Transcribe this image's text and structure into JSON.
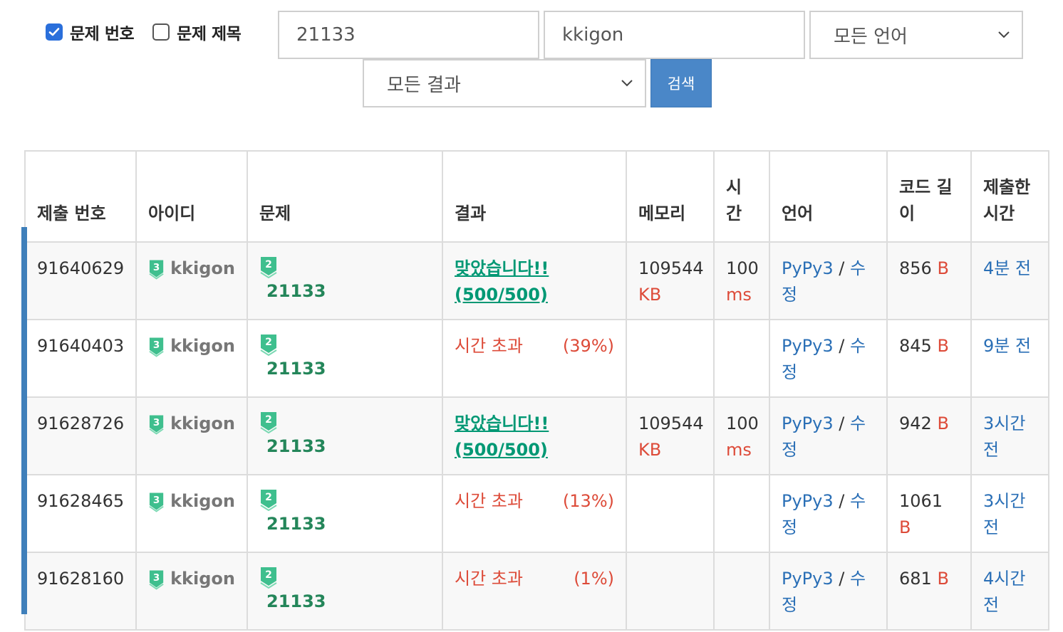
{
  "filters": {
    "problem_number_label": "문제 번호",
    "problem_number_checked": true,
    "problem_title_label": "문제 제목",
    "problem_title_checked": false,
    "problem_input_value": "21133",
    "user_input_value": "kkigon",
    "language_select_value": "모든 언어",
    "result_select_value": "모든 결과",
    "search_button_label": "검색"
  },
  "table": {
    "headers": [
      "제출 번호",
      "아이디",
      "문제",
      "결과",
      "메모리",
      "시간",
      "언어",
      "코드 길이",
      "제출한 시간"
    ],
    "rows": [
      {
        "id": "91640629",
        "user": "kkigon",
        "user_tier": "3",
        "problem": "21133",
        "problem_tier": "2",
        "result": "맞았습니다!! (500/500)",
        "result_score": "",
        "memory": "109544",
        "memory_unit": "KB",
        "time": "100",
        "time_unit": "ms",
        "lang": "PyPy3",
        "edit": "수정",
        "code_len": "856",
        "code_unit": "B",
        "submitted": "4분 전"
      },
      {
        "id": "91640403",
        "user": "kkigon",
        "user_tier": "3",
        "problem": "21133",
        "problem_tier": "2",
        "result": "시간 초과",
        "result_score": "(39%)",
        "memory": "",
        "memory_unit": "",
        "time": "",
        "time_unit": "",
        "lang": "PyPy3",
        "edit": "수정",
        "code_len": "845",
        "code_unit": "B",
        "submitted": "9분 전"
      },
      {
        "id": "91628726",
        "user": "kkigon",
        "user_tier": "3",
        "problem": "21133",
        "problem_tier": "2",
        "result": "맞았습니다!! (500/500)",
        "result_score": "",
        "memory": "109544",
        "memory_unit": "KB",
        "time": "100",
        "time_unit": "ms",
        "lang": "PyPy3",
        "edit": "수정",
        "code_len": "942",
        "code_unit": "B",
        "submitted": "3시간 전"
      },
      {
        "id": "91628465",
        "user": "kkigon",
        "user_tier": "3",
        "problem": "21133",
        "problem_tier": "2",
        "result": "시간 초과",
        "result_score": "(13%)",
        "memory": "",
        "memory_unit": "",
        "time": "",
        "time_unit": "",
        "lang": "PyPy3",
        "edit": "수정",
        "code_len": "1061",
        "code_unit": "B",
        "submitted": "3시간 전"
      },
      {
        "id": "91628160",
        "user": "kkigon",
        "user_tier": "3",
        "problem": "21133",
        "problem_tier": "2",
        "result": "시간 초과",
        "result_score": "(1%)",
        "memory": "",
        "memory_unit": "",
        "time": "",
        "time_unit": "",
        "lang": "PyPy3",
        "edit": "수정",
        "code_len": "681",
        "code_unit": "B",
        "submitted": "4시간 전"
      }
    ]
  },
  "colors": {
    "accepted": "#009874",
    "error": "#dd4b39",
    "link": "#2a6fb6",
    "tier_green": "#3fbf8e",
    "button": "#4a87c8"
  }
}
